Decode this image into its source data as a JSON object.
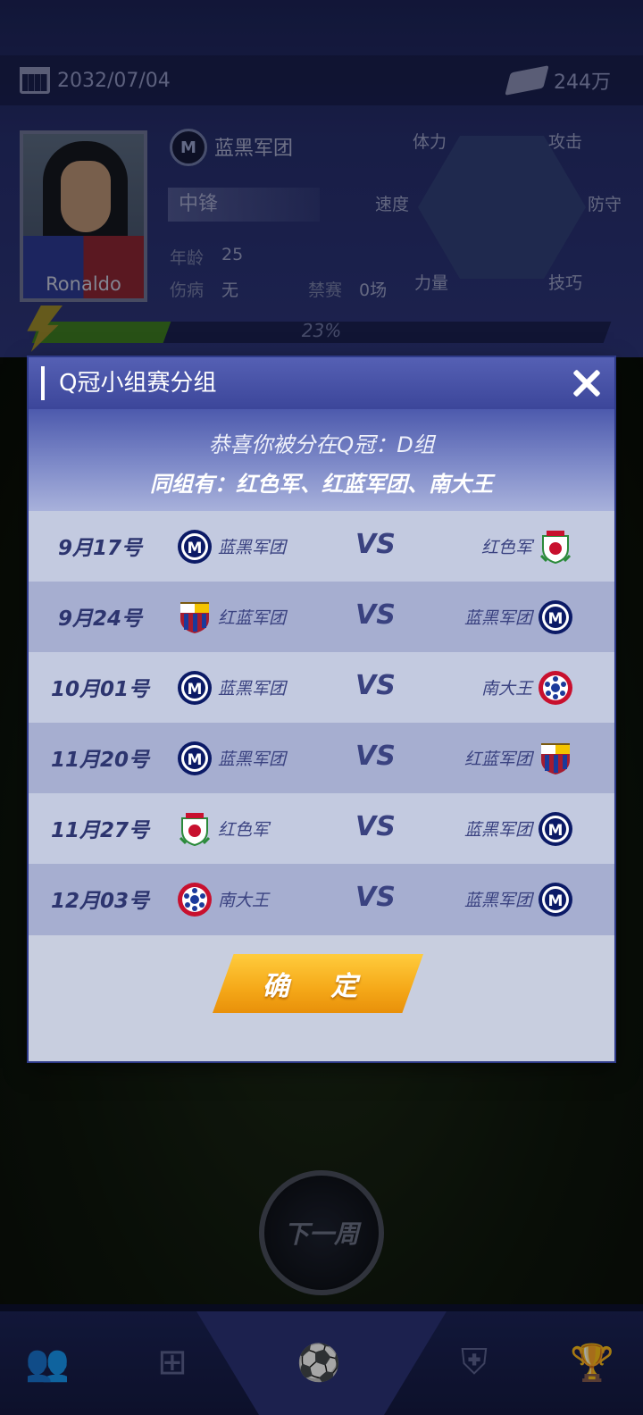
{
  "header": {
    "date": "2032/07/04",
    "money": "244万"
  },
  "player": {
    "name": "Ronaldo",
    "club": "蓝黑军团",
    "position": "中锋",
    "age_label": "年龄",
    "age": "25",
    "injury_label": "伤病",
    "injury": "无",
    "suspension_label": "禁赛",
    "suspension": "0场",
    "radar_labels": {
      "stamina": "体力",
      "attack": "攻击",
      "speed": "速度",
      "defense": "防守",
      "strength": "力量",
      "skill": "技巧"
    },
    "progress_text": "23%",
    "progress_value": 0.23
  },
  "next_week": "下一周",
  "modal": {
    "title": "Q冠小组赛分组",
    "line1": "恭喜你被分在Q冠：D组",
    "line2": "同组有：红色军、红蓝军团、南大王",
    "vs": "VS",
    "confirm": "确 定"
  },
  "matches": [
    {
      "date": "9月17号",
      "home": "蓝黑军团",
      "home_logo": "blue-black-logo",
      "away": "红色军",
      "away_logo": "red-army-logo"
    },
    {
      "date": "9月24号",
      "home": "红蓝军团",
      "home_logo": "red-blue-logo",
      "away": "蓝黑军团",
      "away_logo": "blue-black-logo"
    },
    {
      "date": "10月01号",
      "home": "蓝黑军团",
      "home_logo": "blue-black-logo",
      "away": "南大王",
      "away_logo": "south-king-logo"
    },
    {
      "date": "11月20号",
      "home": "蓝黑军团",
      "home_logo": "blue-black-logo",
      "away": "红蓝军团",
      "away_logo": "red-blue-logo"
    },
    {
      "date": "11月27号",
      "home": "红色军",
      "home_logo": "red-army-logo",
      "away": "蓝黑军团",
      "away_logo": "blue-black-logo"
    },
    {
      "date": "12月03号",
      "home": "南大王",
      "home_logo": "south-king-logo",
      "away": "蓝黑军团",
      "away_logo": "blue-black-logo"
    }
  ],
  "colors": {
    "modal_header": "#4a55a8",
    "row_light": "#c3cae0",
    "row_dark": "#a6aed0",
    "confirm": "#f5a818",
    "text_dark": "#2d356f"
  }
}
